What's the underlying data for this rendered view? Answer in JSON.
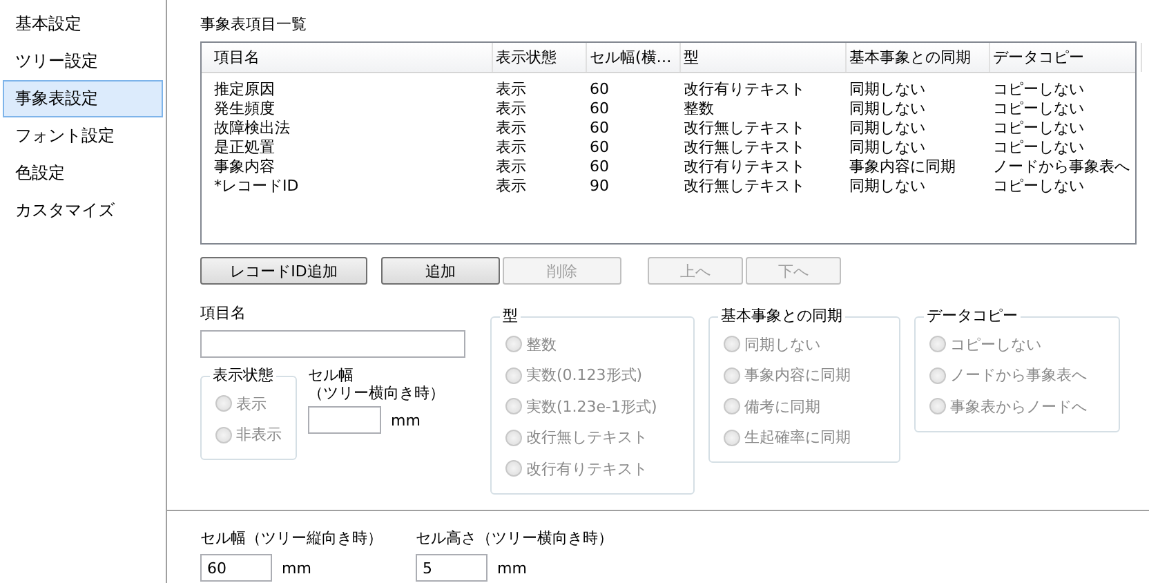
{
  "sidebar": {
    "items": [
      {
        "label": "基本設定",
        "selected": false
      },
      {
        "label": "ツリー設定",
        "selected": false
      },
      {
        "label": "事象表設定",
        "selected": true
      },
      {
        "label": "フォント設定",
        "selected": false
      },
      {
        "label": "色設定",
        "selected": false
      },
      {
        "label": "カスタマイズ",
        "selected": false
      }
    ]
  },
  "item_list": {
    "title": "事象表項目一覧",
    "columns": [
      "項目名",
      "表示状態",
      "セル幅(横…",
      "型",
      "基本事象との同期",
      "データコピー"
    ],
    "rows": [
      [
        "推定原因",
        "表示",
        "60",
        "改行有りテキスト",
        "同期しない",
        "コピーしない"
      ],
      [
        "発生頻度",
        "表示",
        "60",
        "整数",
        "同期しない",
        "コピーしない"
      ],
      [
        "故障検出法",
        "表示",
        "60",
        "改行無しテキスト",
        "同期しない",
        "コピーしない"
      ],
      [
        "是正処置",
        "表示",
        "60",
        "改行無しテキスト",
        "同期しない",
        "コピーしない"
      ],
      [
        "事象内容",
        "表示",
        "60",
        "改行有りテキスト",
        "事象内容に同期",
        "ノードから事象表へ"
      ],
      [
        "*レコードID",
        "表示",
        "90",
        "改行無しテキスト",
        "同期しない",
        "コピーしない"
      ]
    ]
  },
  "buttons": [
    {
      "label": "レコードID追加",
      "disabled": false
    },
    {
      "label": "追加",
      "disabled": false
    },
    {
      "label": "削除",
      "disabled": true
    },
    {
      "label": "上へ",
      "disabled": true
    },
    {
      "label": "下へ",
      "disabled": true
    }
  ],
  "item_name": {
    "label": "項目名"
  },
  "display_state": {
    "title": "表示状態",
    "disabled": true,
    "options": [
      {
        "label": "表示",
        "selected": false
      },
      {
        "label": "非表示",
        "selected": false
      }
    ]
  },
  "cell_width_horizontal": {
    "label_lines": [
      "セル幅",
      "（ツリー横向き時）"
    ],
    "unit": "mm"
  },
  "option_groups": [
    {
      "title": "型",
      "disabled": true,
      "options": [
        {
          "label": "整数",
          "selected": false
        },
        {
          "label": "実数(0.123形式)",
          "selected": false
        },
        {
          "label": "実数(1.23e-1形式)",
          "selected": false
        },
        {
          "label": "改行無しテキスト",
          "selected": false
        },
        {
          "label": "改行有りテキスト",
          "selected": false
        }
      ]
    },
    {
      "title": "基本事象との同期",
      "disabled": true,
      "options": [
        {
          "label": "同期しない",
          "selected": false
        },
        {
          "label": "事象内容に同期",
          "selected": false
        },
        {
          "label": "備考に同期",
          "selected": false
        },
        {
          "label": "生起確率に同期",
          "selected": false
        }
      ]
    },
    {
      "title": "データコピー",
      "disabled": true,
      "options": [
        {
          "label": "コピーしない",
          "selected": false
        },
        {
          "label": "ノードから事象表へ",
          "selected": false
        },
        {
          "label": "事象表からノードへ",
          "selected": false
        }
      ]
    }
  ],
  "bottom_fields": [
    {
      "label": "セル幅（ツリー縦向き時）",
      "value": "60",
      "unit": "mm"
    },
    {
      "label": "セル高さ（ツリー横向き時）",
      "value": "5",
      "unit": "mm"
    }
  ]
}
